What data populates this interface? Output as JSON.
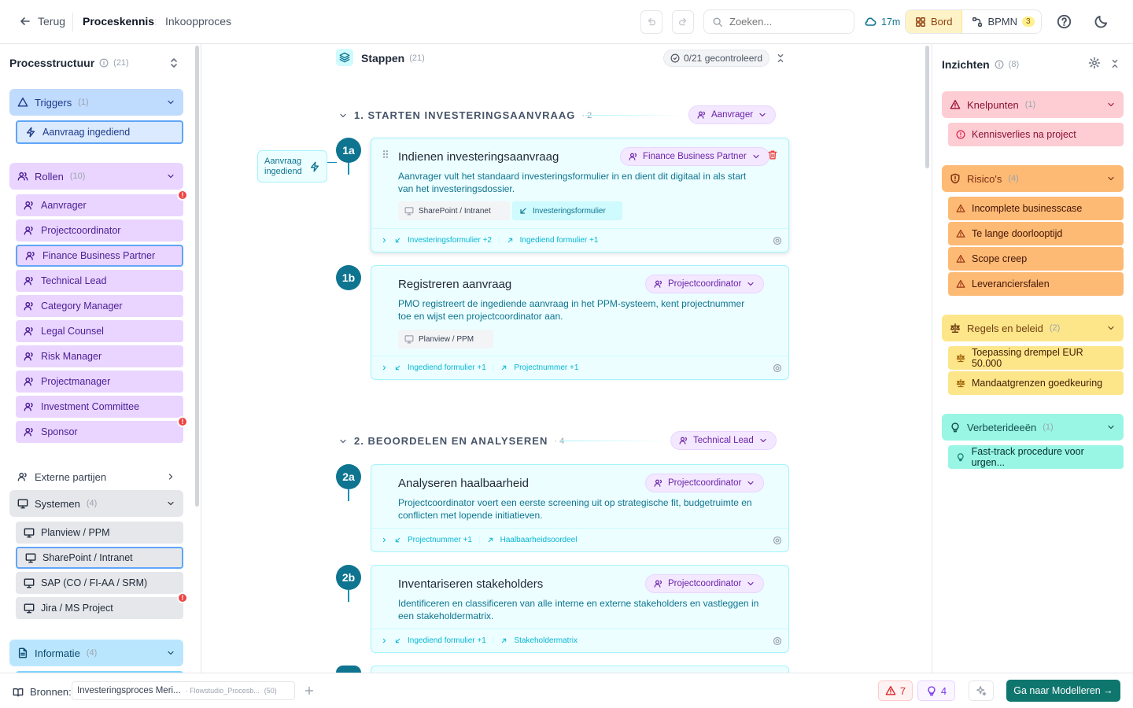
{
  "header": {
    "back_label": "Terug",
    "title": "Proceskennis",
    "subtitle": "Inkoopproces",
    "search_placeholder": "Zoeken...",
    "sync_time": "17m",
    "view_board": "Bord",
    "view_bpmn": "BPMN",
    "bpmn_badge": "3"
  },
  "left": {
    "title": "Processtructuur",
    "count": "(21)",
    "triggers": {
      "label": "Triggers",
      "count": "(1)",
      "items": [
        "Aanvraag ingediend"
      ]
    },
    "roles": {
      "label": "Rollen",
      "count": "(10)",
      "items": [
        "Aanvrager",
        "Projectcoordinator",
        "Finance Business Partner",
        "Technical Lead",
        "Category Manager",
        "Legal Counsel",
        "Risk Manager",
        "Projectmanager",
        "Investment Committee",
        "Sponsor"
      ]
    },
    "external": {
      "label": "Externe partijen"
    },
    "systems": {
      "label": "Systemen",
      "count": "(4)",
      "items": [
        "Planview / PPM",
        "SharePoint / Intranet",
        "SAP (CO / FI-AA / SRM)",
        "Jira / MS Project"
      ]
    },
    "info": {
      "label": "Informatie",
      "count": "(4)"
    },
    "badge": "!"
  },
  "center": {
    "title": "Stappen",
    "count": "(21)",
    "checked": "0/21 gecontroleerd",
    "trigger_label": "Aanvraag ingediend",
    "phases": [
      {
        "label": "1. STARTEN INVESTERINGSAANVRAAG",
        "count": "· 2",
        "role": "Aanvrager"
      },
      {
        "label": "2. BEOORDELEN EN ANALYSEREN",
        "count": "· 4",
        "role": "Technical Lead"
      }
    ],
    "steps": [
      {
        "num": "1a",
        "title": "Indienen investeringsaanvraag",
        "role": "Finance Business Partner",
        "desc": "Aanvrager vult het standaard investeringsformulier in en dient dit digitaal in als start van het investeringsdossier.",
        "system": "SharePoint / Intranet",
        "info": "Investeringsformulier",
        "input": "Investeringsformulier +2",
        "output": "Ingediend formulier +1"
      },
      {
        "num": "1b",
        "title": "Registreren aanvraag",
        "role": "Projectcoordinator",
        "desc": "PMO registreert de ingediende aanvraag in het PPM-systeem, kent projectnummer toe en wijst een projectcoordinator aan.",
        "system": "Planview / PPM",
        "input": "Ingediend formulier +1",
        "output": "Projectnummer +1"
      },
      {
        "num": "2a",
        "title": "Analyseren haalbaarheid",
        "role": "Projectcoordinator",
        "desc": "Projectcoordinator voert een eerste screening uit op strategische fit, budgetruimte en conflicten met lopende initiatieven.",
        "input": "Projectnummer +1",
        "output": "Haalbaarheidsoordeel"
      },
      {
        "num": "2b",
        "title": "Inventariseren stakeholders",
        "role": "Projectcoordinator",
        "desc": "Identificeren en classificeren van alle interne en externe stakeholders en vastleggen in een stakeholdermatrix.",
        "input": "Ingediend formulier +1",
        "output": "Stakeholdermatrix"
      }
    ]
  },
  "right": {
    "title": "Inzichten",
    "count": "(8)",
    "knelpunten": {
      "label": "Knelpunten",
      "count": "(1)",
      "items": [
        "Kennisverlies na project"
      ]
    },
    "risicos": {
      "label": "Risico's",
      "count": "(4)",
      "items": [
        "Incomplete businesscase",
        "Te lange doorlooptijd",
        "Scope creep",
        "Leveranciersfalen"
      ]
    },
    "regels": {
      "label": "Regels en beleid",
      "count": "(2)",
      "items": [
        "Toepassing drempel EUR 50.000",
        "Mandaatgrenzen goedkeuring"
      ]
    },
    "verbeter": {
      "label": "Verbeterideeën",
      "count": "(1)",
      "items": [
        "Fast-track procedure voor urgen..."
      ]
    }
  },
  "footer": {
    "sources_label": "Bronnen:",
    "source_name": "Investeringsproces Meri...",
    "source_file": "· Flowstudio_Procesb...",
    "source_count": "(50)",
    "warnings": "7",
    "ideas": "4",
    "cta": "Ga naar Modelleren →"
  },
  "colors": {
    "accent": "#0e7490",
    "role": "#e9d5ff",
    "trigger": "#bfdbfe",
    "system": "#e5e7eb",
    "risk": "#fdba74",
    "problem": "#fecdd3",
    "rule": "#fde68a",
    "idea": "#99f6e4"
  }
}
